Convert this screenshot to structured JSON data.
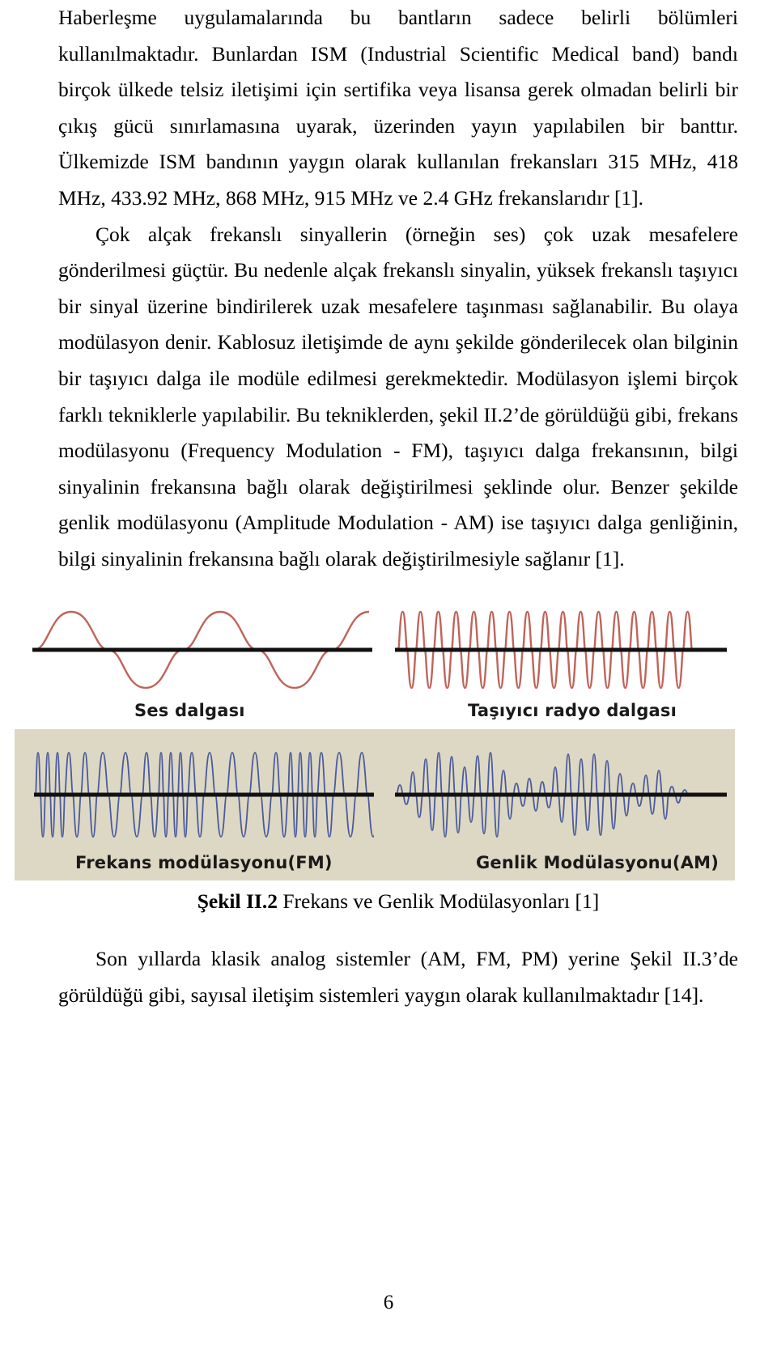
{
  "document": {
    "page_number": "6",
    "paragraphs": [
      {
        "id": "p1",
        "indent": false,
        "text": "Haberleşme uygulamalarında bu bantların sadece belirli bölümleri kullanılmaktadır.  Bunlardan ISM (Industrial Scientific Medical band) bandı birçok ülkede telsiz iletişimi için sertifika veya lisansa gerek olmadan belirli bir çıkış gücü sınırlamasına uyarak, üzerinden yayın yapılabilen bir banttır.  Ülkemizde ISM bandının yaygın olarak kullanılan frekansları 315 MHz, 418 MHz, 433.92 MHz, 868 MHz, 915 MHz ve 2.4 GHz frekanslarıdır [1]."
      },
      {
        "id": "p2",
        "indent": true,
        "text": "Çok alçak frekanslı sinyallerin (örneğin ses) çok uzak mesafelere gönderilmesi güçtür.  Bu nedenle alçak frekanslı sinyalin, yüksek frekanslı taşıyıcı bir sinyal üzerine bindirilerek uzak mesafelere taşınması sağlanabilir.  Bu olaya modülasyon denir.  Kablosuz iletişimde de aynı şekilde gönderilecek olan bilginin bir taşıyıcı dalga ile modüle edilmesi gerekmektedir.  Modülasyon işlemi birçok farklı tekniklerle yapılabilir.  Bu tekniklerden, şekil II.2’de görüldüğü gibi, frekans modülasyonu (Frequency Modulation - FM), taşıyıcı dalga frekansının, bilgi sinyalinin frekansına bağlı olarak değiştirilmesi şeklinde olur.  Benzer şekilde genlik modülasyonu (Amplitude Modulation - AM) ise taşıyıcı dalga genliğinin, bilgi sinyalinin frekansına bağlı olarak değiştirilmesiyle sağlanır [1]."
      }
    ],
    "trailing_paragraph": {
      "id": "p3",
      "indent": true,
      "text": "Son yıllarda klasik analog sistemler (AM, FM, PM) yerine Şekil II.3’de görüldüğü gibi, sayısal iletişim sistemleri yaygın olarak kullanılmaktadır [14]."
    }
  },
  "figure": {
    "caption_prefix": "Şekil II.2",
    "caption_text": " Frekans ve Genlik Modülasyonları [1]",
    "colors": {
      "top_background": "#ffffff",
      "bottom_background": "#ddd8c4",
      "carrier_wave": "#c0645a",
      "modulated_wave": "#4a5a9c",
      "axis": "#111111"
    },
    "panels": [
      {
        "id": "ses-dalgasi",
        "label": "Ses dalgası",
        "wave": "low-frequency-sine",
        "cycles": 3,
        "color": "#c0645a"
      },
      {
        "id": "tasiyici-radyo-dalgasi",
        "label": "Taşıyıcı radyo dalgası",
        "wave": "high-frequency-sine",
        "cycles": 17,
        "color": "#c0645a"
      },
      {
        "id": "frekans-modulasyonu",
        "label": "Frekans modülasyonu(FM)",
        "wave": "frequency-modulated",
        "color": "#4a5a9c"
      },
      {
        "id": "genlik-modulasyonu",
        "label": "Genlik Modülasyonu(AM)",
        "wave": "amplitude-modulated",
        "color": "#4a5a9c"
      }
    ]
  }
}
